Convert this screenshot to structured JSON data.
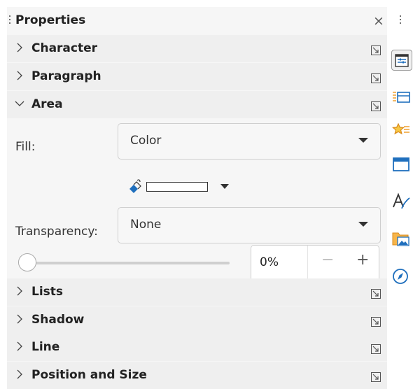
{
  "panel": {
    "title": "Properties",
    "close_glyph": "×",
    "icons": {
      "grip": "drag-handle-icon",
      "close": "close-icon",
      "more_options": "more-options-icon"
    }
  },
  "sections": {
    "character": {
      "label": "Character",
      "expanded": false
    },
    "paragraph": {
      "label": "Paragraph",
      "expanded": false
    },
    "area": {
      "label": "Area",
      "expanded": true
    },
    "lists": {
      "label": "Lists",
      "expanded": false
    },
    "shadow": {
      "label": "Shadow",
      "expanded": false
    },
    "line": {
      "label": "Line",
      "expanded": false
    },
    "position_size": {
      "label": "Position and Size",
      "expanded": false
    }
  },
  "area": {
    "fill_label": "Fill:",
    "fill_value": "Color",
    "fill_color": "#ffffff",
    "transparency_label": "Transparency:",
    "transparency_value": "None",
    "transparency_percent": "0%",
    "transparency_level": 0,
    "minus_glyph": "−",
    "plus_glyph": "+"
  },
  "sidebar": {
    "menu_icon": "vertical-ellipsis-icon",
    "tabs": [
      {
        "icon": "properties-icon",
        "active": true
      },
      {
        "icon": "styles-icon",
        "active": false
      },
      {
        "icon": "animation-icon",
        "active": false
      },
      {
        "icon": "master-slides-icon",
        "active": false
      },
      {
        "icon": "text-style-icon",
        "active": false
      },
      {
        "icon": "gallery-icon",
        "active": false
      },
      {
        "icon": "navigator-icon",
        "active": false
      }
    ]
  },
  "colors": {
    "panel_bg": "#f6f6f6",
    "section_bg": "#efefef",
    "accent_blue": "#1f6fbd",
    "accent_orange": "#f0a030"
  }
}
